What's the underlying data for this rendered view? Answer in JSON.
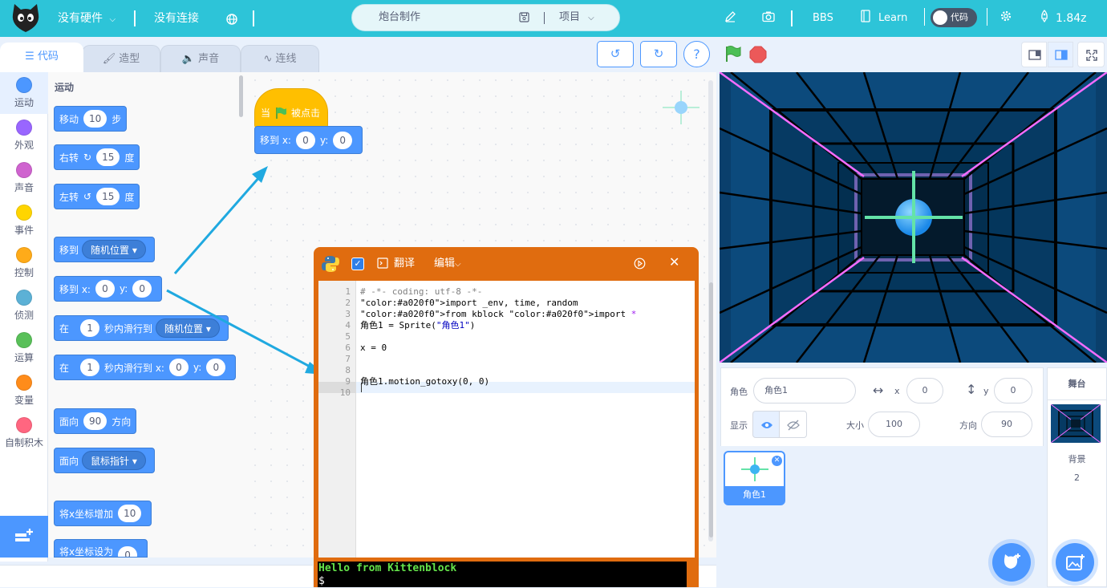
{
  "topbar": {
    "hardware": "没有硬件",
    "connection": "没有连接",
    "project_name": "炮台制作",
    "project_menu": "项目",
    "bbs": "BBS",
    "learn": "Learn",
    "code_toggle": "代码",
    "version": "1.84z"
  },
  "tabs": [
    {
      "label": "代码"
    },
    {
      "label": "造型"
    },
    {
      "label": "声音"
    },
    {
      "label": "连线"
    }
  ],
  "categories": [
    {
      "label": "运动",
      "color": "#4c97ff"
    },
    {
      "label": "外观",
      "color": "#9966ff"
    },
    {
      "label": "声音",
      "color": "#cf63cf"
    },
    {
      "label": "事件",
      "color": "#ffd500"
    },
    {
      "label": "控制",
      "color": "#ffab19"
    },
    {
      "label": "侦测",
      "color": "#5cb1d6"
    },
    {
      "label": "运算",
      "color": "#59c059"
    },
    {
      "label": "变量",
      "color": "#ff8c1a"
    },
    {
      "label": "自制积木",
      "color": "#ff6680"
    }
  ],
  "palette": {
    "section": "运动",
    "move": {
      "a": "移动",
      "v": "10",
      "b": "步"
    },
    "turn_right": {
      "a": "右转",
      "v": "15",
      "b": "度"
    },
    "turn_left": {
      "a": "左转",
      "v": "15",
      "b": "度"
    },
    "goto": {
      "a": "移到",
      "dd": "随机位置"
    },
    "gotoxy": {
      "a": "移到 x:",
      "x": "0",
      "yl": "y:",
      "y": "0"
    },
    "glide": {
      "a": "在",
      "v": "1",
      "b": "秒内滑行到",
      "dd": "随机位置"
    },
    "glidexy": {
      "a": "在",
      "v": "1",
      "b": "秒内滑行到 x:",
      "x": "0",
      "yl": "y:",
      "y": "0"
    },
    "point": {
      "a": "面向",
      "v": "90",
      "b": "方向"
    },
    "point_to": {
      "a": "面向",
      "dd": "鼠标指针"
    },
    "change_x": {
      "a": "将x坐标增加",
      "v": "10"
    },
    "set_x": {
      "a": "将x坐标设为",
      "v": "0"
    }
  },
  "script": {
    "hat": {
      "a": "当",
      "b": "被点击"
    },
    "gotoxy": {
      "a": "移到 x:",
      "x": "0",
      "yl": "y:",
      "y": "0"
    }
  },
  "python": {
    "translate": "翻译",
    "edit": "编辑",
    "lines": [
      "# -*- coding: utf-8 -*-",
      "import _env, time, random",
      "from kblock import *",
      "角色1 = Sprite(\"角色1\")",
      "",
      "x = 0",
      "",
      "",
      "角色1.motion_gotoxy(0, 0)",
      ""
    ],
    "line_numbers": [
      "1",
      "2",
      "3",
      "4",
      "5",
      "6",
      "7",
      "8",
      "9",
      "10"
    ],
    "console": [
      "Hello from Kittenblock",
      "$"
    ]
  },
  "sprite_info": {
    "sprite_label": "角色",
    "sprite_name": "角色1",
    "x_label": "x",
    "x_value": "0",
    "y_label": "y",
    "y_value": "0",
    "show_label": "显示",
    "size_label": "大小",
    "size_value": "100",
    "direction_label": "方向",
    "direction_value": "90"
  },
  "sprites": [
    {
      "name": "角色1"
    }
  ],
  "stage_panel": {
    "title": "舞台",
    "backdrop_label": "背景",
    "backdrop_count": "2"
  }
}
